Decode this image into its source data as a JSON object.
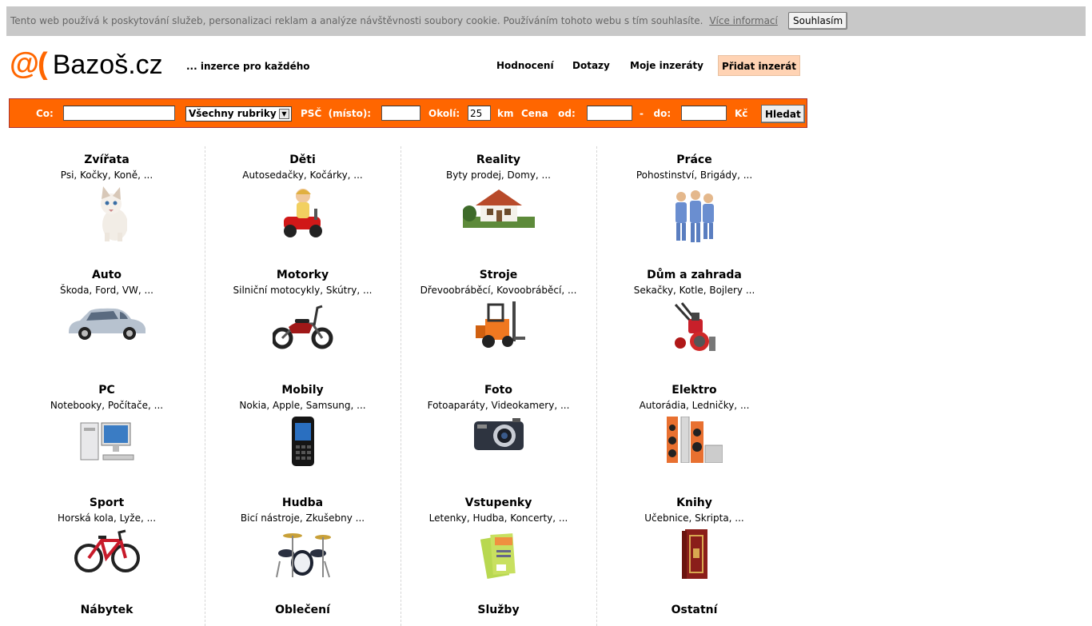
{
  "cookie_bar": {
    "message": "Tento web používá k poskytování služeb, personalizaci reklam a analýze návštěvnosti soubory cookie. Používáním tohoto webu s tím souhlasíte.",
    "more_link": "Více informací",
    "agree_button": "Souhlasím"
  },
  "header": {
    "logo_prefix": "@(",
    "logo_name": "Bazoš.cz",
    "tagline": "... inzerce pro každého",
    "nav": [
      "Hodnocení",
      "Dotazy",
      "Moje inzeráty",
      "Přidat inzerát"
    ]
  },
  "search": {
    "what_label": "Co:",
    "what_value": "",
    "category_select": "Všechny rubriky",
    "zip_label": "PSČ  (místo):",
    "zip_value": "",
    "radius_label": "Okolí:",
    "radius_value": "25",
    "radius_unit": "km",
    "price_label": "Cena   od:",
    "price_from_value": "",
    "price_to_label": "-   do:",
    "price_to_value": "",
    "currency": "Kč",
    "search_button": "Hledat"
  },
  "categories": [
    {
      "title": "Zvířata",
      "sub": "Psi, Kočky, Koně, ...",
      "icon": "cat-icon"
    },
    {
      "title": "Děti",
      "sub": "Autosedačky, Kočárky, ...",
      "icon": "child-toy-icon"
    },
    {
      "title": "Reality",
      "sub": "Byty prodej, Domy, ...",
      "icon": "house-icon"
    },
    {
      "title": "Práce",
      "sub": "Pohostinství, Brigády, ...",
      "icon": "workers-icon"
    },
    {
      "title": "Auto",
      "sub": "Škoda, Ford, VW, ...",
      "icon": "car-icon"
    },
    {
      "title": "Motorky",
      "sub": "Silniční motocykly, Skútry, ...",
      "icon": "moped-icon"
    },
    {
      "title": "Stroje",
      "sub": "Dřevoobráběcí, Kovoobráběcí, ...",
      "icon": "forklift-icon"
    },
    {
      "title": "Dům a zahrada",
      "sub": "Sekačky, Kotle, Bojlery ...",
      "icon": "tiller-icon"
    },
    {
      "title": "PC",
      "sub": "Notebooky, Počítače, ...",
      "icon": "computer-icon"
    },
    {
      "title": "Mobily",
      "sub": "Nokia, Apple, Samsung, ...",
      "icon": "mobile-phone-icon"
    },
    {
      "title": "Foto",
      "sub": "Fotoaparáty, Videokamery, ...",
      "icon": "camera-icon"
    },
    {
      "title": "Elektro",
      "sub": "Autorádia, Ledničky, ...",
      "icon": "speakers-icon"
    },
    {
      "title": "Sport",
      "sub": "Horská kola, Lyže, ...",
      "icon": "bicycle-icon"
    },
    {
      "title": "Hudba",
      "sub": "Bicí nástroje, Zkušebny ...",
      "icon": "drums-icon"
    },
    {
      "title": "Vstupenky",
      "sub": "Letenky, Hudba, Koncerty, ...",
      "icon": "tickets-icon"
    },
    {
      "title": "Knihy",
      "sub": "Učebnice, Skripta, ...",
      "icon": "book-icon"
    },
    {
      "title": "Nábytek",
      "sub": "",
      "icon": ""
    },
    {
      "title": "Oblečení",
      "sub": "",
      "icon": ""
    },
    {
      "title": "Služby",
      "sub": "",
      "icon": ""
    },
    {
      "title": "Ostatní",
      "sub": "",
      "icon": ""
    }
  ]
}
